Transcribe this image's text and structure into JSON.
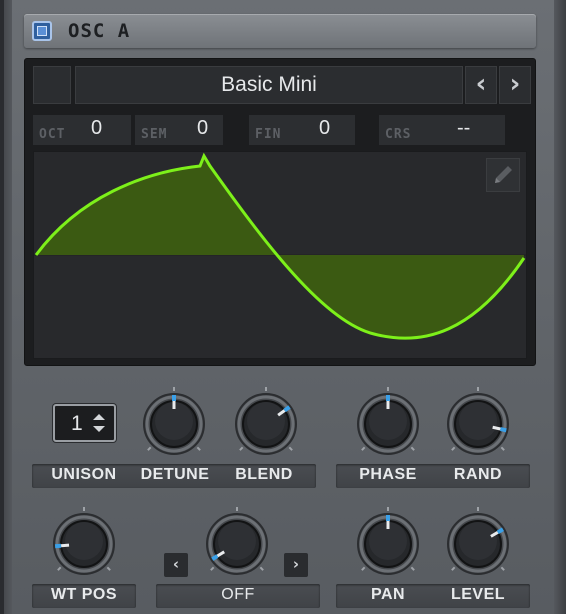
{
  "header": {
    "title": "OSC A",
    "enabled": true
  },
  "wavetable": {
    "name": "Basic Mini",
    "prev_label": "‹",
    "next_label": "›"
  },
  "params": [
    {
      "label": "OCT",
      "value": "0"
    },
    {
      "label": "SEM",
      "value": "0"
    },
    {
      "label": "FIN",
      "value": "0"
    },
    {
      "label": "CRS",
      "value": "--"
    }
  ],
  "wave": {
    "color": "#7df01a",
    "fill": "#3b5a12",
    "icon": "pencil-icon"
  },
  "unison": {
    "value": "1"
  },
  "knobs": {
    "detune": {
      "label": "DETUNE",
      "level": 0.5
    },
    "blend": {
      "label": "BLEND",
      "level": 0.7
    },
    "phase": {
      "label": "PHASE",
      "level": 0.5
    },
    "rand": {
      "label": "RAND",
      "level": 0.88
    },
    "wt_pos": {
      "label": "WT POS",
      "level": 0.15
    },
    "warp": {
      "label": "OFF",
      "level": 0.05
    },
    "pan": {
      "label": "PAN",
      "level": 0.5
    },
    "level": {
      "label": "LEVEL",
      "level": 0.72
    }
  },
  "unison_label": "UNISON",
  "warp_prev": "‹",
  "warp_next": "›",
  "accent_color": "#3aa0e8"
}
